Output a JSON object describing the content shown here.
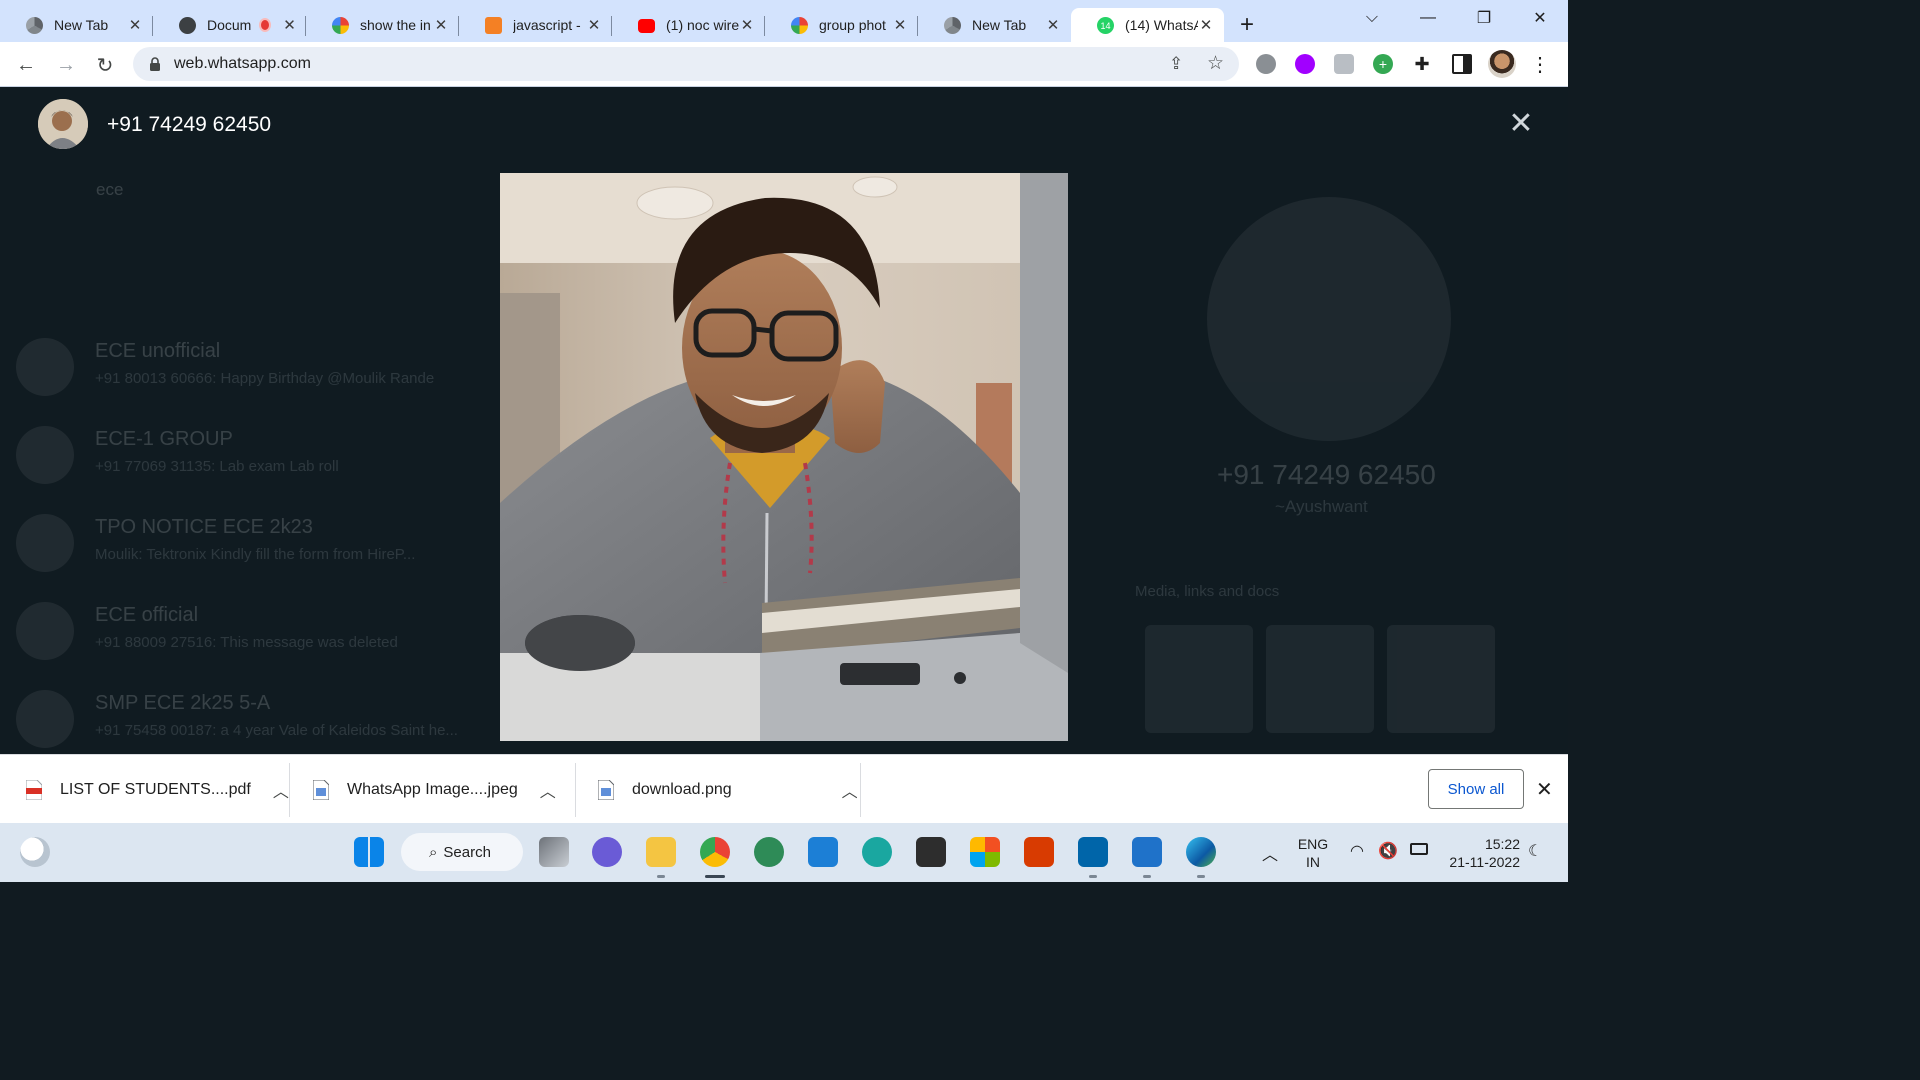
{
  "browser": {
    "tabs": [
      {
        "label": "New Tab",
        "icon": "chrome-icon"
      },
      {
        "label": "Docum",
        "icon": "globe-icon",
        "recording": true
      },
      {
        "label": "show the in",
        "icon": "google-icon"
      },
      {
        "label": "javascript -",
        "icon": "stackoverflow-icon"
      },
      {
        "label": "(1) noc wire",
        "icon": "youtube-icon"
      },
      {
        "label": "group phot",
        "icon": "google-icon"
      },
      {
        "label": "New Tab",
        "icon": "chrome-icon"
      },
      {
        "label": "(14) WhatsA",
        "icon": "whatsapp-icon",
        "badge": "14",
        "active": true
      }
    ],
    "url": "web.whatsapp.com"
  },
  "viewer": {
    "title": "+91 74249 62450",
    "close_label": "✕"
  },
  "background_chats": {
    "search": "ece",
    "items": [
      {
        "name": "ECE unofficial",
        "message": "+91 80013 60666: Happy Birthday @Moulik Rande"
      },
      {
        "name": "ECE-1 GROUP",
        "message": "+91 77069 31135: Lab exam Lab roll"
      },
      {
        "name": "TPO NOTICE ECE 2k23",
        "message": "Moulik: Tektronix Kindly fill the form from HireP..."
      },
      {
        "name": "ECE official",
        "message": "+91 88009 27516: This message was deleted"
      },
      {
        "name": "SMP ECE 2k25 5-A",
        "message": "+91 75458 00187: a 4 year Vale of Kaleidos Saint he..."
      }
    ]
  },
  "background_contact": {
    "number": "+91 74249 62450",
    "name": "~Ayushwant",
    "media_label": "Media, links and docs"
  },
  "downloads": {
    "items": [
      {
        "name": "LIST OF STUDENTS....pdf",
        "type": "pdf"
      },
      {
        "name": "WhatsApp Image....jpeg",
        "type": "image"
      },
      {
        "name": "download.png",
        "type": "image"
      }
    ],
    "show_all": "Show all"
  },
  "taskbar": {
    "search_label": "Search",
    "lang_top": "ENG",
    "lang_bottom": "IN",
    "time": "15:22",
    "date": "21-11-2022"
  },
  "colors": {
    "tabstrip": "#d3e3fd",
    "viewer_bg": "#101b21",
    "show_all": "#0b57d0"
  }
}
